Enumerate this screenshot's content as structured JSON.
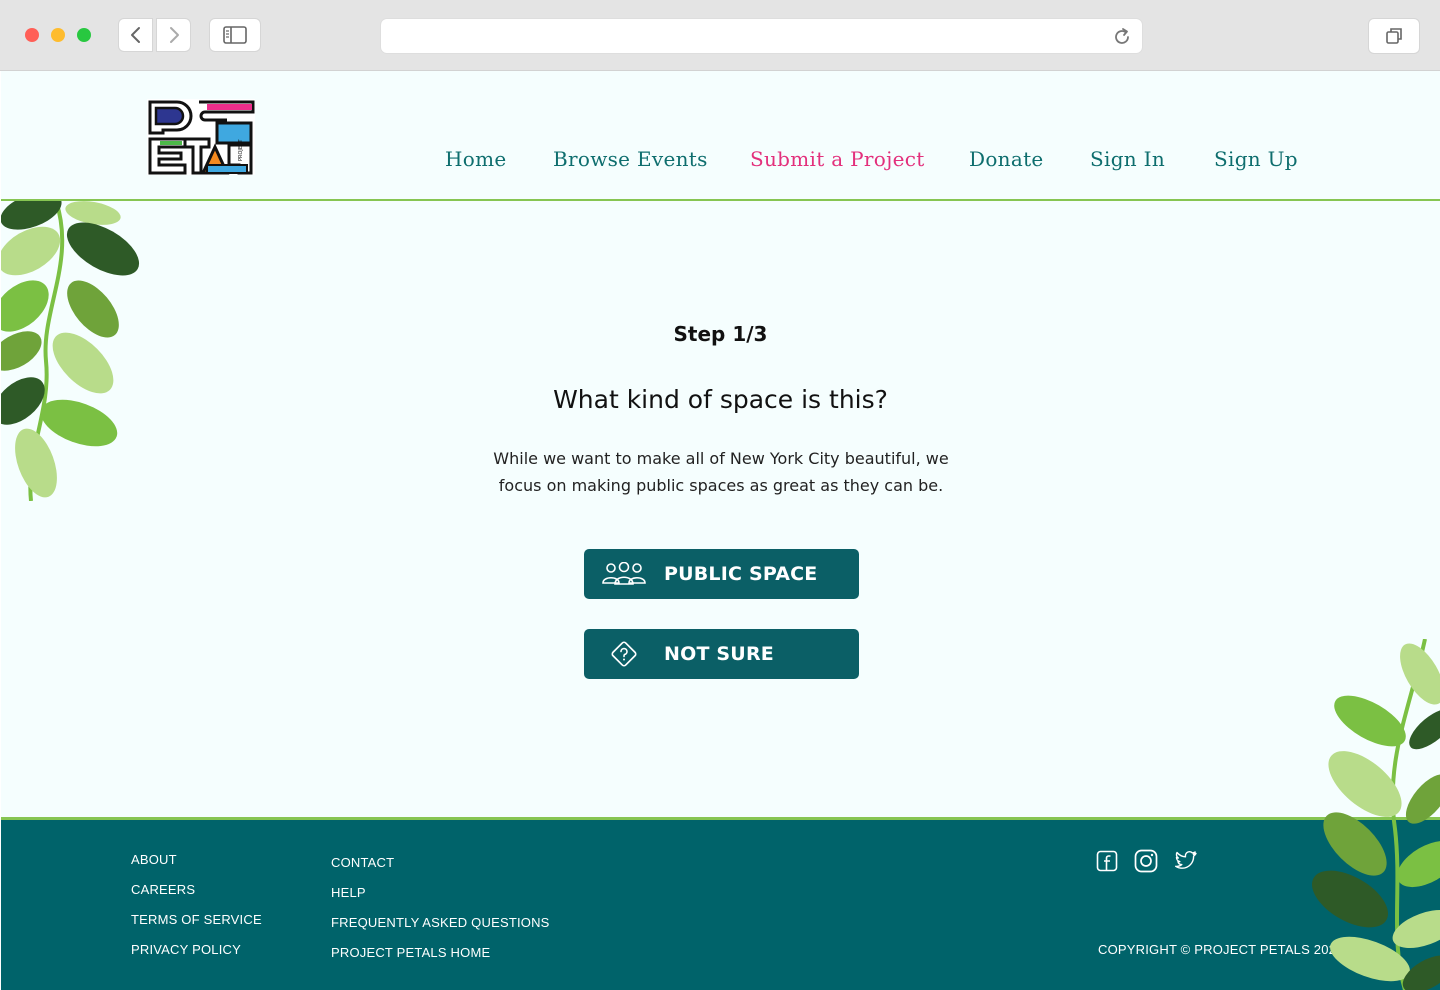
{
  "browser": {
    "address": {
      "value": "",
      "placeholder": ""
    }
  },
  "header": {
    "logo_text": "PETAL PROJECT",
    "nav": [
      {
        "label": "Home",
        "active": false
      },
      {
        "label": "Browse Events",
        "active": false
      },
      {
        "label": "Submit a Project",
        "active": true
      },
      {
        "label": "Donate",
        "active": false
      },
      {
        "label": "Sign In",
        "active": false
      },
      {
        "label": "Sign Up",
        "active": false
      }
    ]
  },
  "main": {
    "step": "Step 1/3",
    "question": "What kind of space is this?",
    "description": "While we want to make all of New York City beautiful, we focus on making public spaces as great as they can be.",
    "choices": [
      {
        "label": "PUBLIC SPACE",
        "icon": "people-icon"
      },
      {
        "label": "NOT SURE",
        "icon": "question-diamond-icon"
      }
    ]
  },
  "footer": {
    "column1": [
      "ABOUT",
      "CAREERS",
      "TERMS OF SERVICE",
      "PRIVACY POLICY"
    ],
    "column2": [
      "CONTACT",
      "HELP",
      "FREQUENTLY ASKED QUESTIONS",
      "PROJECT PETALS HOME"
    ],
    "social": [
      "facebook-icon",
      "instagram-icon",
      "twitter-icon"
    ],
    "copyright": "COPYRIGHT © PROJECT PETALS 2020"
  },
  "colors": {
    "primary": "#0b5f66",
    "nav_text": "#0e6e6e",
    "nav_active": "#e3307c",
    "accent_green": "#86c552",
    "footer_bg": "#00636a",
    "page_bg": "#f5fefe"
  }
}
